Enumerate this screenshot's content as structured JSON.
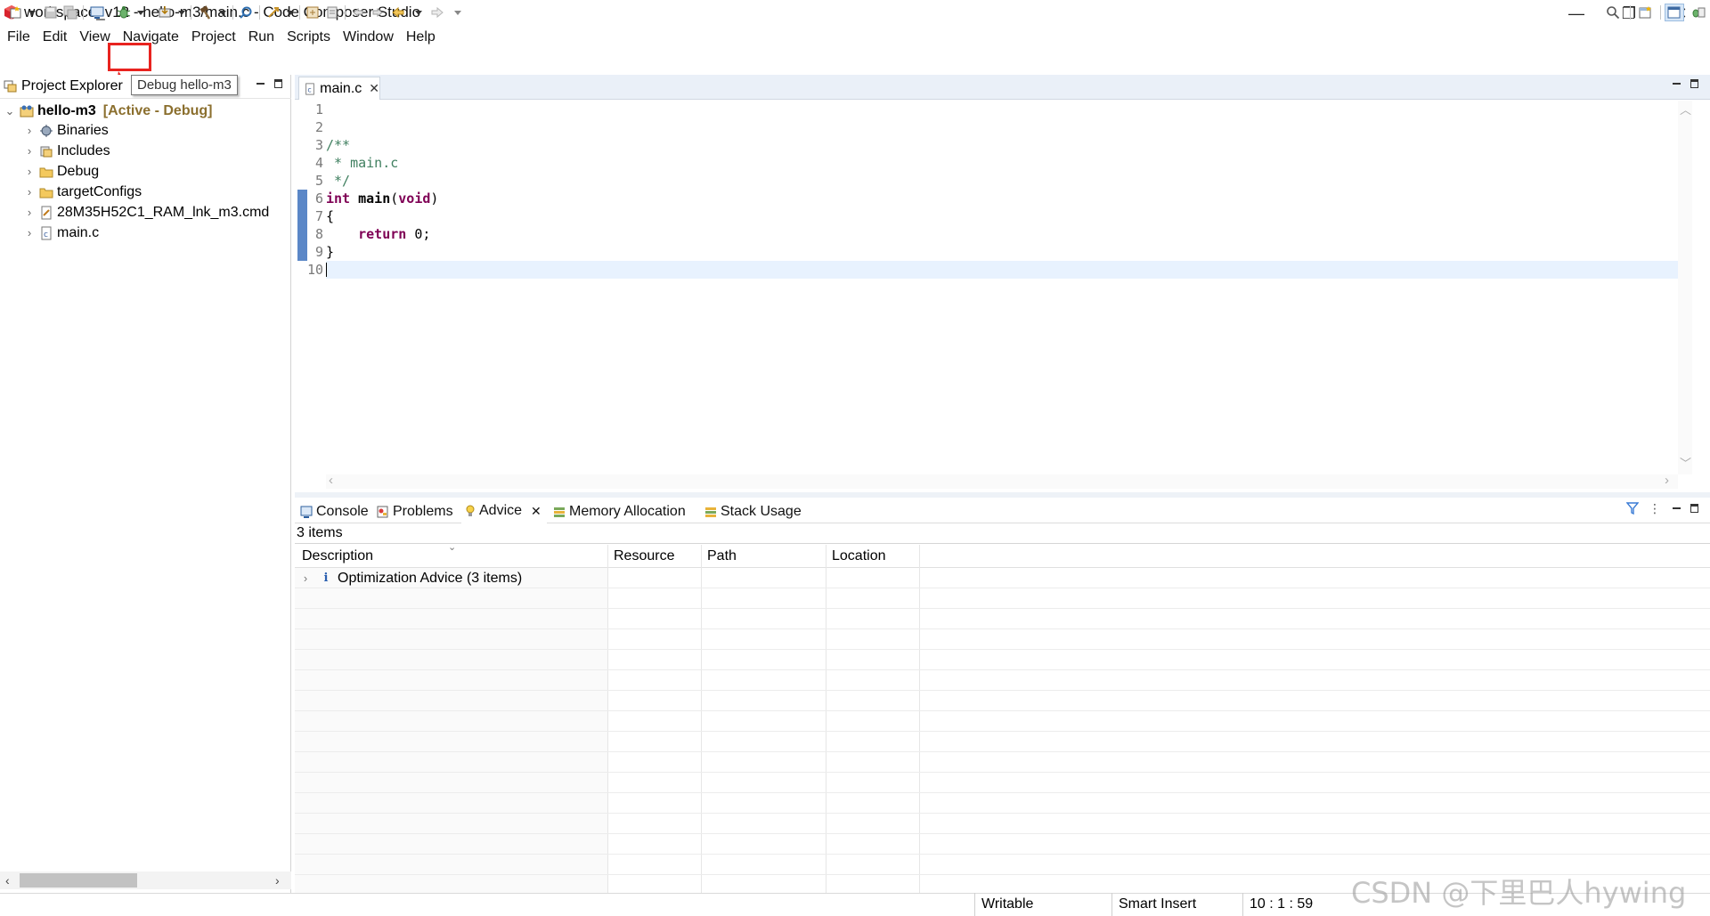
{
  "window": {
    "title": "workspace_v12 - hello-m3/main.c - Code Composer Studio",
    "controls": {
      "minimize": "—",
      "maximize": "❐",
      "close": "✕"
    }
  },
  "menu": [
    "File",
    "Edit",
    "View",
    "Navigate",
    "Project",
    "Run",
    "Scripts",
    "Window",
    "Help"
  ],
  "toolbar": {
    "tooltip": "Debug hello-m3",
    "icons": [
      "new-icon",
      "save-icon",
      "save-all-icon",
      "terminal-icon",
      "debug-icon",
      "flash-icon",
      "build-icon",
      "search-icon",
      "run-icon",
      "back-icon",
      "forward-icon"
    ]
  },
  "project_explorer": {
    "title": "Project Explorer",
    "project": {
      "name": "hello-m3",
      "status": "[Active - Debug]"
    },
    "items": [
      {
        "label": "Binaries",
        "icon": "binaries-icon"
      },
      {
        "label": "Includes",
        "icon": "includes-icon"
      },
      {
        "label": "Debug",
        "icon": "folder-icon"
      },
      {
        "label": "targetConfigs",
        "icon": "folder-icon"
      },
      {
        "label": "28M35H52C1_RAM_lnk_m3.cmd",
        "icon": "cmd-file-icon"
      },
      {
        "label": "main.c",
        "icon": "c-file-icon"
      }
    ]
  },
  "editor": {
    "tab_label": "main.c",
    "line_numbers": [
      "1",
      "2",
      "3",
      "4",
      "5",
      "6",
      "7",
      "8",
      "9",
      "10"
    ],
    "code": {
      "line3": "/**",
      "line4": " * main.c",
      "line5": " */",
      "line6_kw": "int",
      "line6_fn": "main",
      "line6_paren_open": "(",
      "line6_void": "void",
      "line6_paren_close": ")",
      "line7": "{",
      "line8_kw": "return",
      "line8_rest": " 0;",
      "line9": "}"
    }
  },
  "bottom_panel": {
    "tabs": [
      {
        "label": "Console",
        "icon": "console-icon"
      },
      {
        "label": "Problems",
        "icon": "problems-icon"
      },
      {
        "label": "Advice",
        "icon": "lightbulb-icon",
        "active": true
      },
      {
        "label": "Memory Allocation",
        "icon": "memory-icon"
      },
      {
        "label": "Stack Usage",
        "icon": "stack-icon"
      }
    ],
    "items_count": "3 items",
    "columns": [
      "Description",
      "Resource",
      "Path",
      "Location"
    ],
    "rows": [
      {
        "description": "Optimization Advice (3 items)",
        "icon": "info-icon"
      }
    ]
  },
  "status_bar": {
    "writable": "Writable",
    "insert_mode": "Smart Insert",
    "position": "10 : 1 : 59"
  },
  "watermark": "CSDN @下里巴人hywing",
  "colors": {
    "annotation_red": "#e8231f",
    "keyword": "#7f0055",
    "comment": "#3f7f5f",
    "project_status": "#8b6f2e"
  }
}
